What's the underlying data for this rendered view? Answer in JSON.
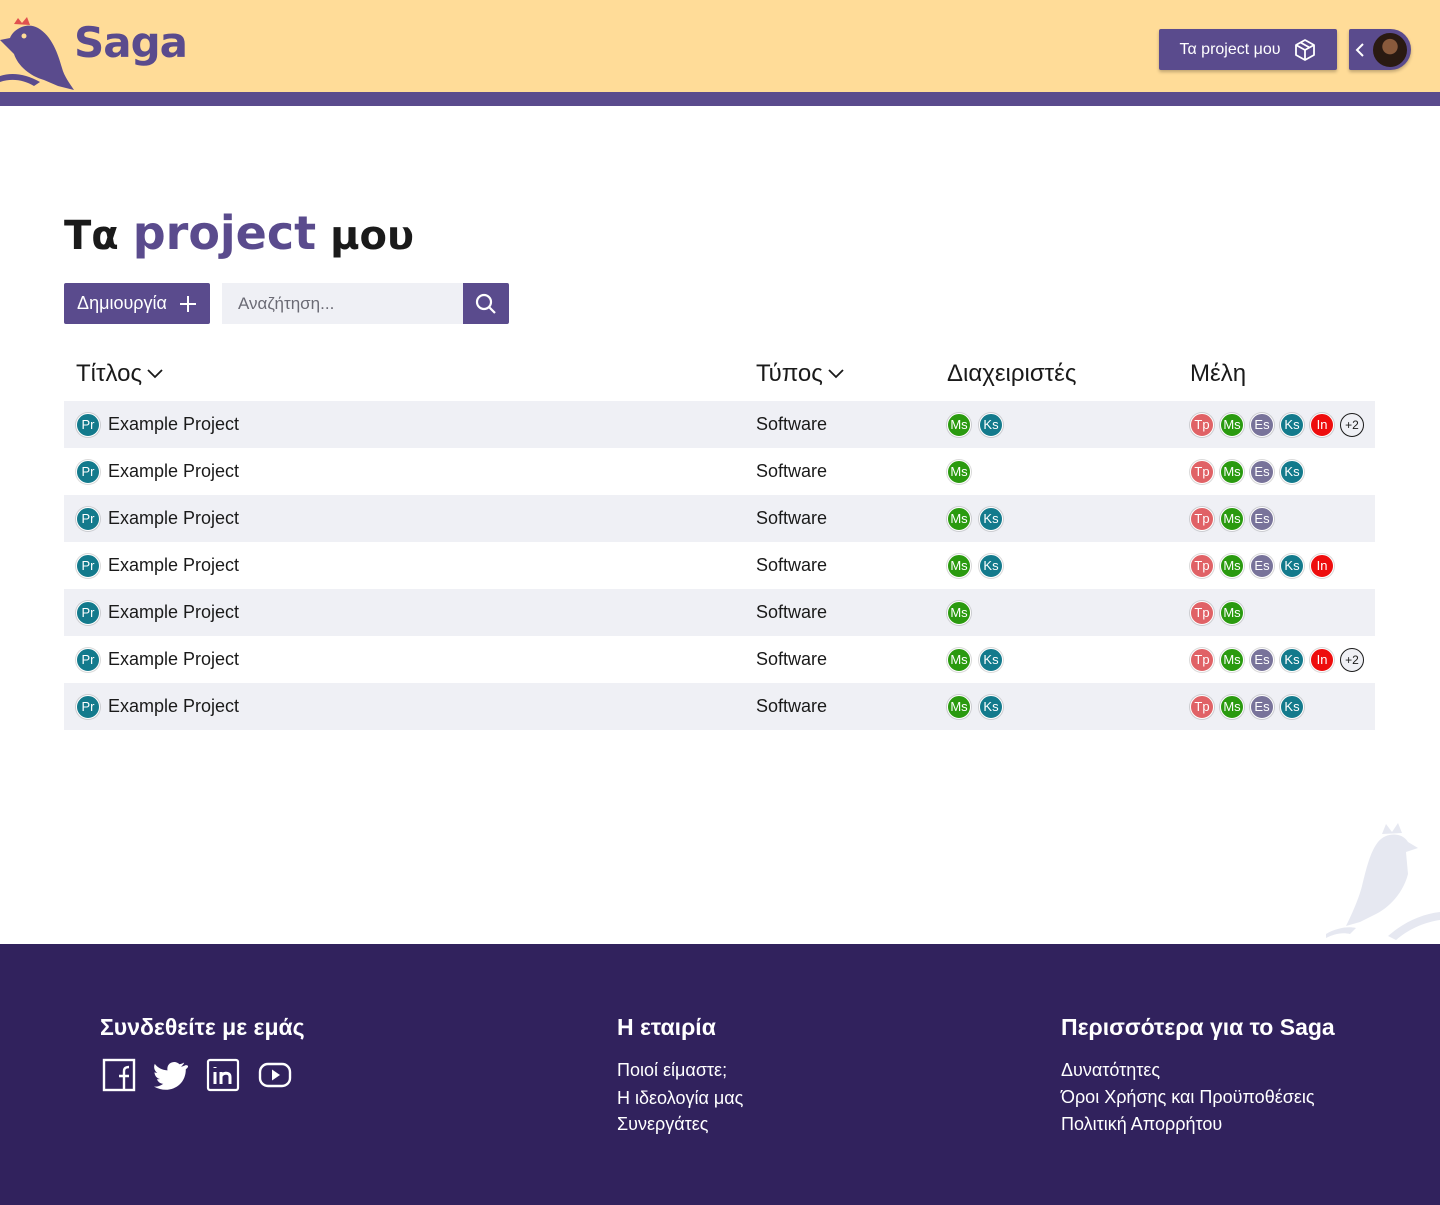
{
  "header": {
    "logo_text": "Saga",
    "my_projects_label": "Τα project μου",
    "brand_color": "#5a4b8d",
    "header_bg": "#ffdc98"
  },
  "page": {
    "title_prefix": "Τα",
    "title_accent": "project",
    "title_suffix": "μου"
  },
  "toolbar": {
    "create_label": "Δημιουργία",
    "search_placeholder": "Αναζήτηση..."
  },
  "table": {
    "headers": {
      "title": "Τίτλος",
      "type": "Τύπος",
      "admins": "Διαχειριστές",
      "members": "Μέλη"
    },
    "rows": [
      {
        "icon": "Pr",
        "title": "Example Project",
        "type": "Software",
        "admins": [
          "Ms",
          "Ks"
        ],
        "members": [
          "Tp",
          "Ms",
          "Es",
          "Ks",
          "In"
        ],
        "more": "+2"
      },
      {
        "icon": "Pr",
        "title": "Example Project",
        "type": "Software",
        "admins": [
          "Ms"
        ],
        "members": [
          "Tp",
          "Ms",
          "Es",
          "Ks"
        ],
        "more": ""
      },
      {
        "icon": "Pr",
        "title": "Example Project",
        "type": "Software",
        "admins": [
          "Ms",
          "Ks"
        ],
        "members": [
          "Tp",
          "Ms",
          "Es"
        ],
        "more": ""
      },
      {
        "icon": "Pr",
        "title": "Example Project",
        "type": "Software",
        "admins": [
          "Ms",
          "Ks"
        ],
        "members": [
          "Tp",
          "Ms",
          "Es",
          "Ks",
          "In"
        ],
        "more": ""
      },
      {
        "icon": "Pr",
        "title": "Example Project",
        "type": "Software",
        "admins": [
          "Ms"
        ],
        "members": [
          "Tp",
          "Ms"
        ],
        "more": ""
      },
      {
        "icon": "Pr",
        "title": "Example Project",
        "type": "Software",
        "admins": [
          "Ms",
          "Ks"
        ],
        "members": [
          "Tp",
          "Ms",
          "Es",
          "Ks",
          "In"
        ],
        "more": "+2"
      },
      {
        "icon": "Pr",
        "title": "Example Project",
        "type": "Software",
        "admins": [
          "Ms",
          "Ks"
        ],
        "members": [
          "Tp",
          "Ms",
          "Es",
          "Ks"
        ],
        "more": ""
      }
    ],
    "badge_colors": {
      "Pr": "#137a8c",
      "Ms": "#2a9a0f",
      "Ks": "#137a8c",
      "Tp": "#e06266",
      "Es": "#78739a",
      "In": "#ee0d0d"
    }
  },
  "footer": {
    "connect_heading": "Συνδεθείτε με εμάς",
    "social_icons": [
      "facebook-icon",
      "twitter-icon",
      "linkedin-icon",
      "youtube-icon"
    ],
    "company_heading": "Η εταιρία",
    "company_links": [
      "Ποιοί είμαστε;",
      "Η ιδεολογία μας",
      "Συνεργάτες"
    ],
    "more_heading": "Περισσότερα για το Saga",
    "more_links": [
      "Δυνατότητες",
      "Όροι Χρήσης και Προϋποθέσεις",
      "Πολιτική Απορρήτου"
    ]
  }
}
